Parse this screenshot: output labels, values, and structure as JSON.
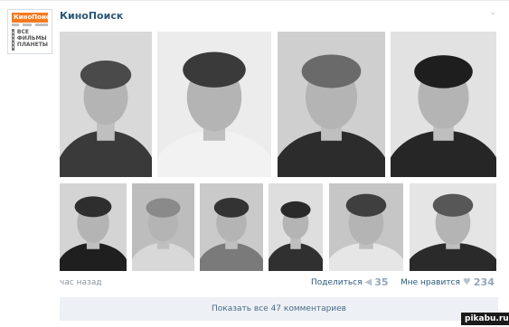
{
  "post": {
    "author": "КиноПоиск",
    "avatar": {
      "logo_text": "КиноПоиск",
      "tagline": "ВСЕ\nФИЛЬМЫ\nПЛАНЕТЫ",
      "accent_color": "#f47a20"
    },
    "menu_icon": "chevron-down-icon",
    "time": "час назад",
    "photos": [
      {
        "row": 1,
        "index": 1,
        "subject": "yearbook-portrait"
      },
      {
        "row": 1,
        "index": 2,
        "subject": "yearbook-portrait"
      },
      {
        "row": 1,
        "index": 3,
        "subject": "yearbook-portrait"
      },
      {
        "row": 1,
        "index": 4,
        "subject": "yearbook-portrait"
      },
      {
        "row": 2,
        "index": 5,
        "subject": "yearbook-portrait"
      },
      {
        "row": 2,
        "index": 6,
        "subject": "yearbook-portrait"
      },
      {
        "row": 2,
        "index": 7,
        "subject": "yearbook-portrait"
      },
      {
        "row": 2,
        "index": 8,
        "subject": "yearbook-portrait"
      },
      {
        "row": 2,
        "index": 9,
        "subject": "yearbook-portrait"
      },
      {
        "row": 2,
        "index": 10,
        "subject": "yearbook-portrait"
      }
    ],
    "actions": {
      "share_label": "Поделиться",
      "share_count": "35",
      "share_icon": "megaphone-icon",
      "like_label": "Мне нравится",
      "like_count": "234",
      "like_icon": "heart-icon"
    },
    "comments_button": "Показать все 47 комментариев"
  },
  "watermark": "pikabu.ru",
  "colors": {
    "link": "#2b587a",
    "muted": "#8a949d",
    "button_bg": "#edf1f5"
  }
}
